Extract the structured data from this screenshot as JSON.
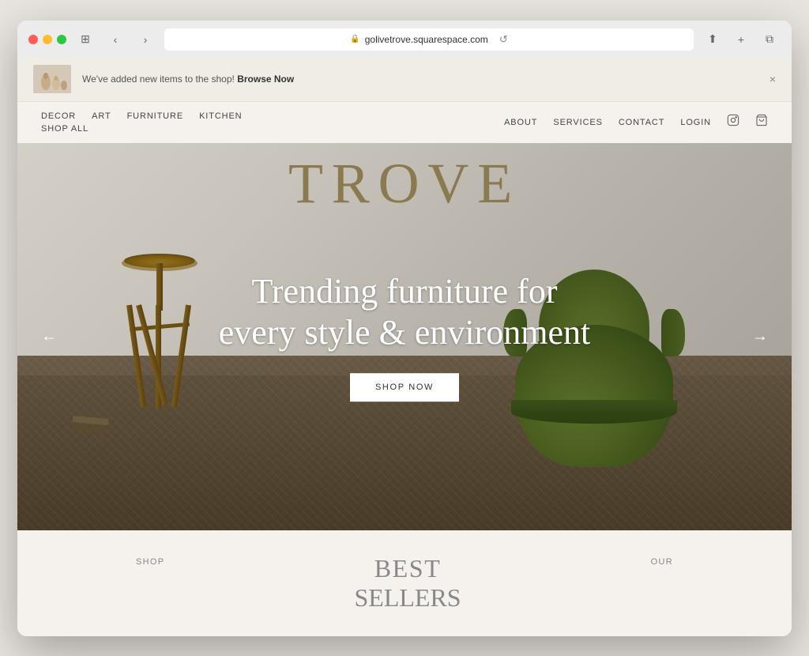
{
  "browser": {
    "url": "golivetrove.squarespace.com",
    "reload_label": "↺"
  },
  "announcement": {
    "text": "We've added new items to the shop!",
    "cta": "Browse Now",
    "close_label": "×"
  },
  "nav_left": {
    "row1": [
      {
        "label": "DECOR",
        "id": "decor"
      },
      {
        "label": "ART",
        "id": "art"
      },
      {
        "label": "FURNITURE",
        "id": "furniture"
      },
      {
        "label": "KITCHEN",
        "id": "kitchen"
      }
    ],
    "row2": [
      {
        "label": "SHOP ALL",
        "id": "shop-all"
      }
    ]
  },
  "nav_right": {
    "links": [
      {
        "label": "ABOUT",
        "id": "about"
      },
      {
        "label": "SERVICES",
        "id": "services"
      },
      {
        "label": "CONTACT",
        "id": "contact"
      },
      {
        "label": "LOGIN",
        "id": "login"
      }
    ]
  },
  "site_title": "TROVE",
  "hero": {
    "headline_line1": "Trending furniture for",
    "headline_line2": "every style & environment",
    "cta_label": "SHOP NOW",
    "prev_label": "←",
    "next_label": "→"
  },
  "bottom": {
    "left_label": "SHOP",
    "center_line1": "BEST",
    "center_line2": "SELLERS",
    "right_label": "OUR"
  },
  "icons": {
    "instagram": "☐",
    "cart": "⊔",
    "lock": "🔒"
  }
}
